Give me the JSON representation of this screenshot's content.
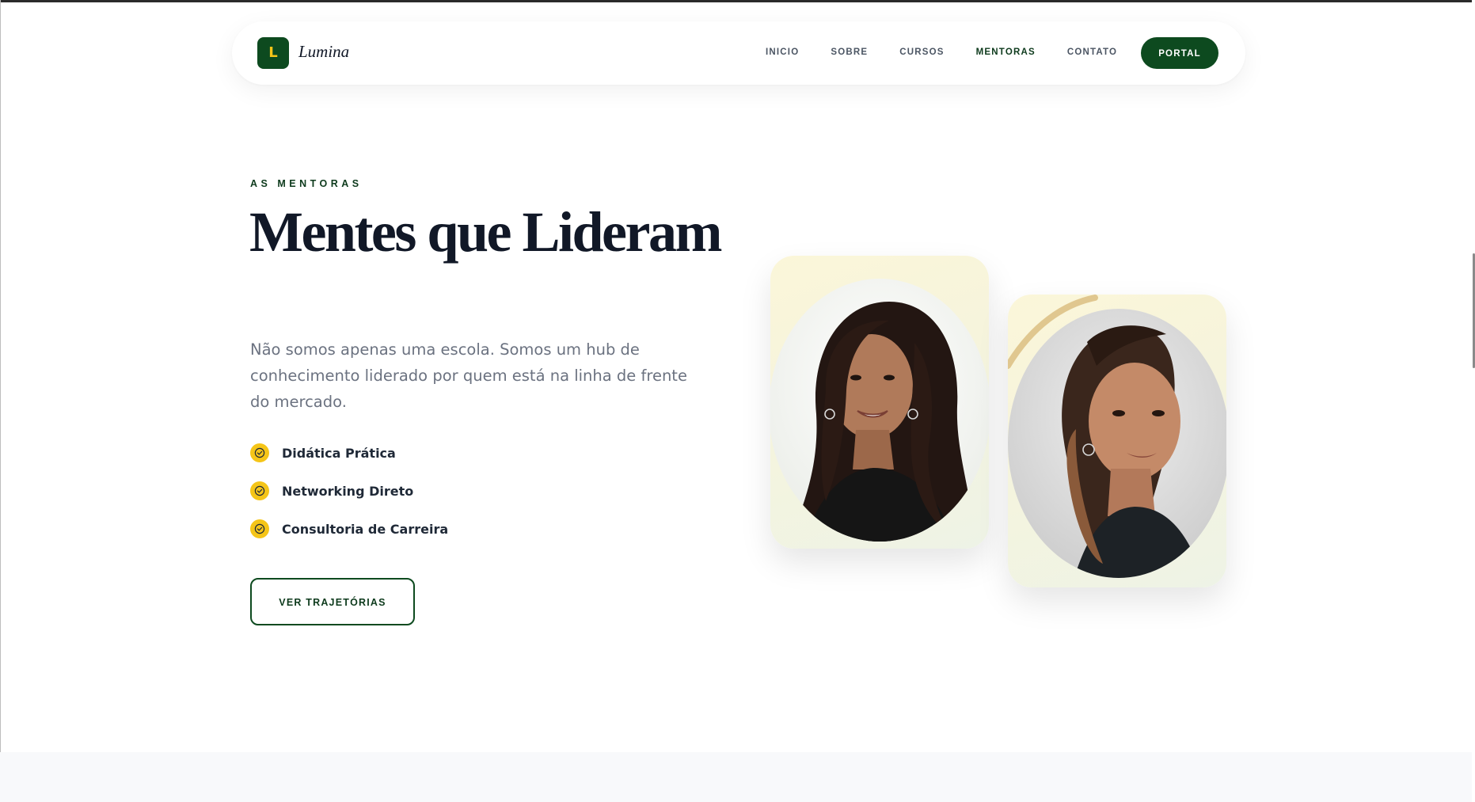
{
  "brand": {
    "logo_letter": "L",
    "name": "Lumina"
  },
  "nav": {
    "items": [
      {
        "label": "INICIO",
        "active": false
      },
      {
        "label": "SOBRE",
        "active": false
      },
      {
        "label": "CURSOS",
        "active": false
      },
      {
        "label": "MENTORAS",
        "active": true
      },
      {
        "label": "CONTATO",
        "active": false
      }
    ],
    "portal_label": "PORTAL"
  },
  "hero": {
    "eyebrow": "AS MENTORAS",
    "title": "Mentes que Lideram",
    "description": "Não somos apenas uma escola. Somos um hub de conhecimento liderado por quem está na linha de frente do mercado.",
    "features": [
      {
        "label": "Didática Prática",
        "icon": "check-circle-icon"
      },
      {
        "label": "Networking Direto",
        "icon": "check-circle-icon"
      },
      {
        "label": "Consultoria de Carreira",
        "icon": "check-circle-icon"
      }
    ],
    "cta_label": "VER TRAJETÓRIAS"
  },
  "mentors": [
    {
      "photo": "mentor-photo-1"
    },
    {
      "photo": "mentor-photo-2"
    }
  ],
  "colors": {
    "brand_green": "#0d4a1f",
    "accent_yellow": "#f5c518",
    "heading": "#111827",
    "muted_text": "#6b7280"
  }
}
